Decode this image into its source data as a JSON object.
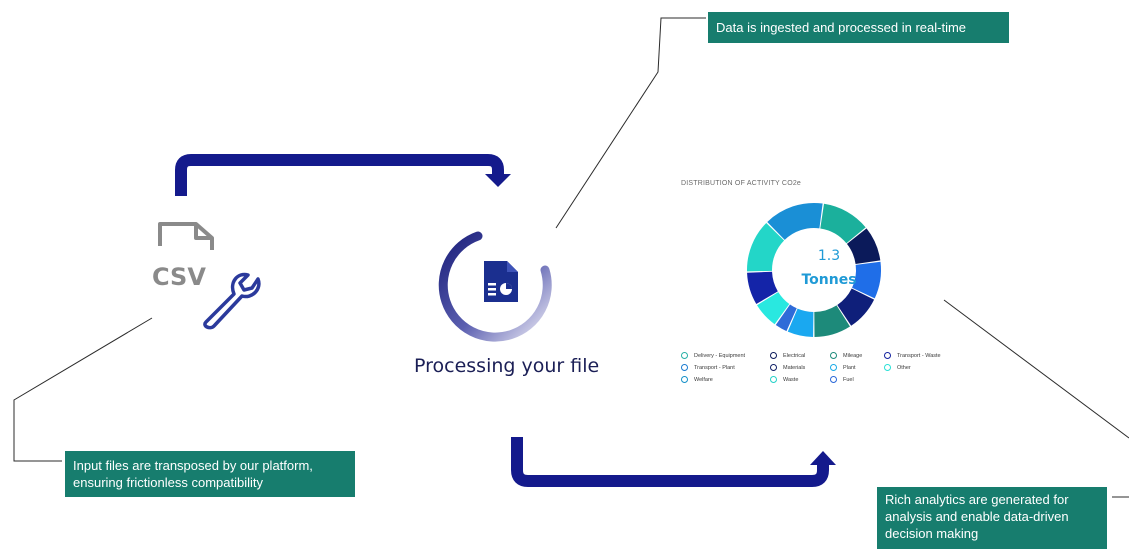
{
  "callouts": {
    "realtime": "Data is ingested and processed in real-time",
    "input": "Input files are transposed by our platform, ensuring frictionless compatibility",
    "analytics": "Rich analytics are generated for analysis and enable data-driven decision making"
  },
  "csv_icon": {
    "label": "CSV"
  },
  "processing": {
    "label": "Processing your file"
  },
  "chart_data": {
    "type": "pie",
    "title": "DISTRIBUTION OF ACTIVITY CO2e",
    "center_value": "1.3",
    "center_unit": "Tonnes",
    "legend": [
      {
        "label": "Delivery - Equipment",
        "color": "#27b0a6"
      },
      {
        "label": "Electrical",
        "color": "#0b1a5a"
      },
      {
        "label": "Mileage",
        "color": "#1d8a7a"
      },
      {
        "label": "Transport - Waste",
        "color": "#14229f"
      },
      {
        "label": "Transport - Plant",
        "color": "#1a7ad0"
      },
      {
        "label": "Materials",
        "color": "#0e1f66"
      },
      {
        "label": "Plant",
        "color": "#18a9e6"
      },
      {
        "label": "Other",
        "color": "#29e0d6"
      },
      {
        "label": "Welfare",
        "color": "#1590c8"
      },
      {
        "label": "Waste",
        "color": "#23d1c8"
      },
      {
        "label": "Fuel",
        "color": "#2a67d8"
      }
    ],
    "slices": [
      {
        "color": "#1bb09c",
        "value": 11
      },
      {
        "color": "#0b1a5a",
        "value": 8
      },
      {
        "color": "#1f6ee8",
        "value": 8.5
      },
      {
        "color": "#0f1f7a",
        "value": 8
      },
      {
        "color": "#1d8a7a",
        "value": 8.5
      },
      {
        "color": "#1aa8f0",
        "value": 6
      },
      {
        "color": "#2f6bd8",
        "value": 3
      },
      {
        "color": "#29e8e0",
        "value": 6
      },
      {
        "color": "#1424a8",
        "value": 7.5
      },
      {
        "color": "#23d6c8",
        "value": 12
      },
      {
        "color": "#1a8fd6",
        "value": 13.5
      }
    ]
  },
  "colors": {
    "arrow": "#141a8c",
    "callout": "#177d6e",
    "icon_gray": "#8a8a8a",
    "icon_blue": "#2b3a9c"
  }
}
